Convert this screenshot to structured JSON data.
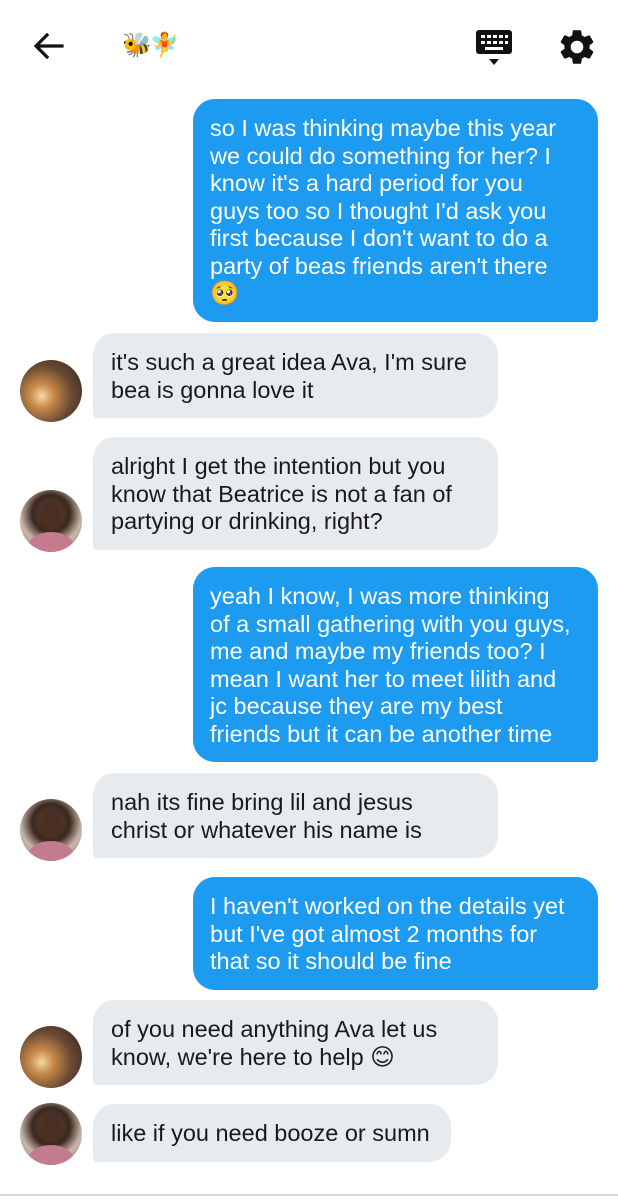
{
  "header": {
    "title_emoji": "🐝🧚",
    "back_icon": "arrow-left-icon",
    "keyboard_icon": "keyboard-icon",
    "settings_icon": "gear-icon"
  },
  "colors": {
    "outgoing": "#1d9bf0",
    "incoming": "#e7ebee"
  },
  "messages": [
    {
      "side": "out",
      "text": "so I was thinking maybe this year\nwe could do something for her? I\nknow it's a hard period for you\nguys too so I thought I'd ask you\nfirst because I don't want to do a\nparty of beas friends aren't there\n🥺"
    },
    {
      "side": "in",
      "avatar": "sunset",
      "text": "it's such a great idea Ava, I'm sure\nbea is gonna love it"
    },
    {
      "side": "in",
      "avatar": "girl",
      "text": "alright I get the intention but you\nknow that Beatrice is not a fan of\npartying or drinking, right?"
    },
    {
      "side": "out",
      "text": "yeah I know, I was more thinking\nof a small gathering with you guys,\nme and maybe my friends too? I\nmean I want her to meet lilith and\njc because they are my best\nfriends but it can be another time"
    },
    {
      "side": "in",
      "avatar": "girl",
      "text": "nah its fine bring lil and jesus\nchrist or whatever his name is"
    },
    {
      "side": "out",
      "text": "I haven't worked on the details yet\nbut I've got almost 2 months for\nthat so it should be fine"
    },
    {
      "side": "in",
      "avatar": "sunset",
      "text": "of you need anything Ava let us\nknow, we're here to help 😊"
    },
    {
      "side": "in",
      "avatar": "girl",
      "text": "like if you need booze or sumn"
    }
  ]
}
